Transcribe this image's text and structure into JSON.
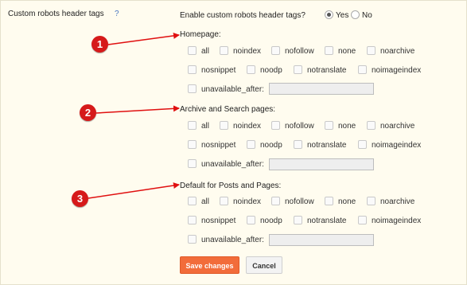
{
  "setting": {
    "title": "Custom robots header tags",
    "help": "?",
    "enable_question": "Enable custom robots header tags?",
    "yes": "Yes",
    "no": "No",
    "selected": "Yes"
  },
  "sections": [
    {
      "badge": "1",
      "title": "Homepage:",
      "row1": [
        "all",
        "noindex",
        "nofollow",
        "none",
        "noarchive"
      ],
      "row2": [
        "nosnippet",
        "noodp",
        "notranslate",
        "noimageindex"
      ],
      "unavailable_label": "unavailable_after:",
      "unavailable_value": ""
    },
    {
      "badge": "2",
      "title": "Archive and Search pages:",
      "row1": [
        "all",
        "noindex",
        "nofollow",
        "none",
        "noarchive"
      ],
      "row2": [
        "nosnippet",
        "noodp",
        "notranslate",
        "noimageindex"
      ],
      "unavailable_label": "unavailable_after:",
      "unavailable_value": ""
    },
    {
      "badge": "3",
      "title": "Default for Posts and Pages:",
      "row1": [
        "all",
        "noindex",
        "nofollow",
        "none",
        "noarchive"
      ],
      "row2": [
        "nosnippet",
        "noodp",
        "notranslate",
        "noimageindex"
      ],
      "unavailable_label": "unavailable_after:",
      "unavailable_value": ""
    }
  ],
  "buttons": {
    "save": "Save changes",
    "cancel": "Cancel"
  },
  "colors": {
    "background": "#fffcef",
    "badge": "#d61a1a",
    "arrow": "#e01010",
    "save_button": "#f26c3a",
    "help": "#4a78c2"
  }
}
